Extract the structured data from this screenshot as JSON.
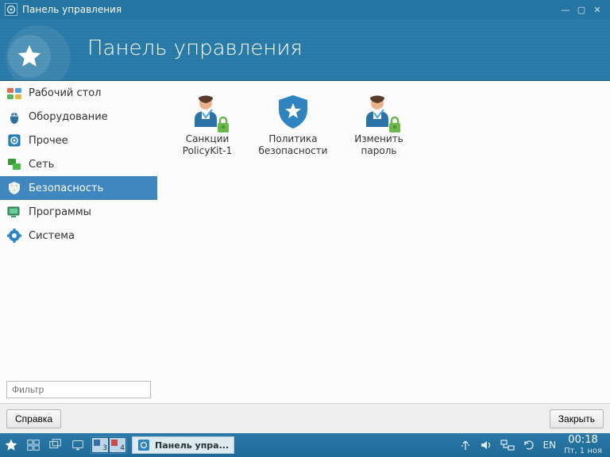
{
  "window_title": "Панель управления",
  "header_title": "Панель управления",
  "sidebar": {
    "items": [
      {
        "label": "Рабочий стол",
        "icon": "desktop"
      },
      {
        "label": "Оборудование",
        "icon": "hardware"
      },
      {
        "label": "Прочее",
        "icon": "other"
      },
      {
        "label": "Сеть",
        "icon": "network"
      },
      {
        "label": "Безопасность",
        "icon": "security",
        "selected": true
      },
      {
        "label": "Программы",
        "icon": "programs"
      },
      {
        "label": "Система",
        "icon": "system"
      }
    ],
    "filter_placeholder": "Фильтр"
  },
  "content": {
    "items": [
      {
        "label": "Санкции PolicyKit-1",
        "icon": "user-lock"
      },
      {
        "label": "Политика безопасности",
        "icon": "shield"
      },
      {
        "label": "Изменить пароль",
        "icon": "user-lock"
      }
    ]
  },
  "footer": {
    "help_label": "Справка",
    "close_label": "Закрыть"
  },
  "taskbar": {
    "desks": [
      "3",
      "4"
    ],
    "task_label": "Панель упра...",
    "lang": "EN",
    "time": "00:18",
    "date": "Пт, 1 ноя"
  }
}
